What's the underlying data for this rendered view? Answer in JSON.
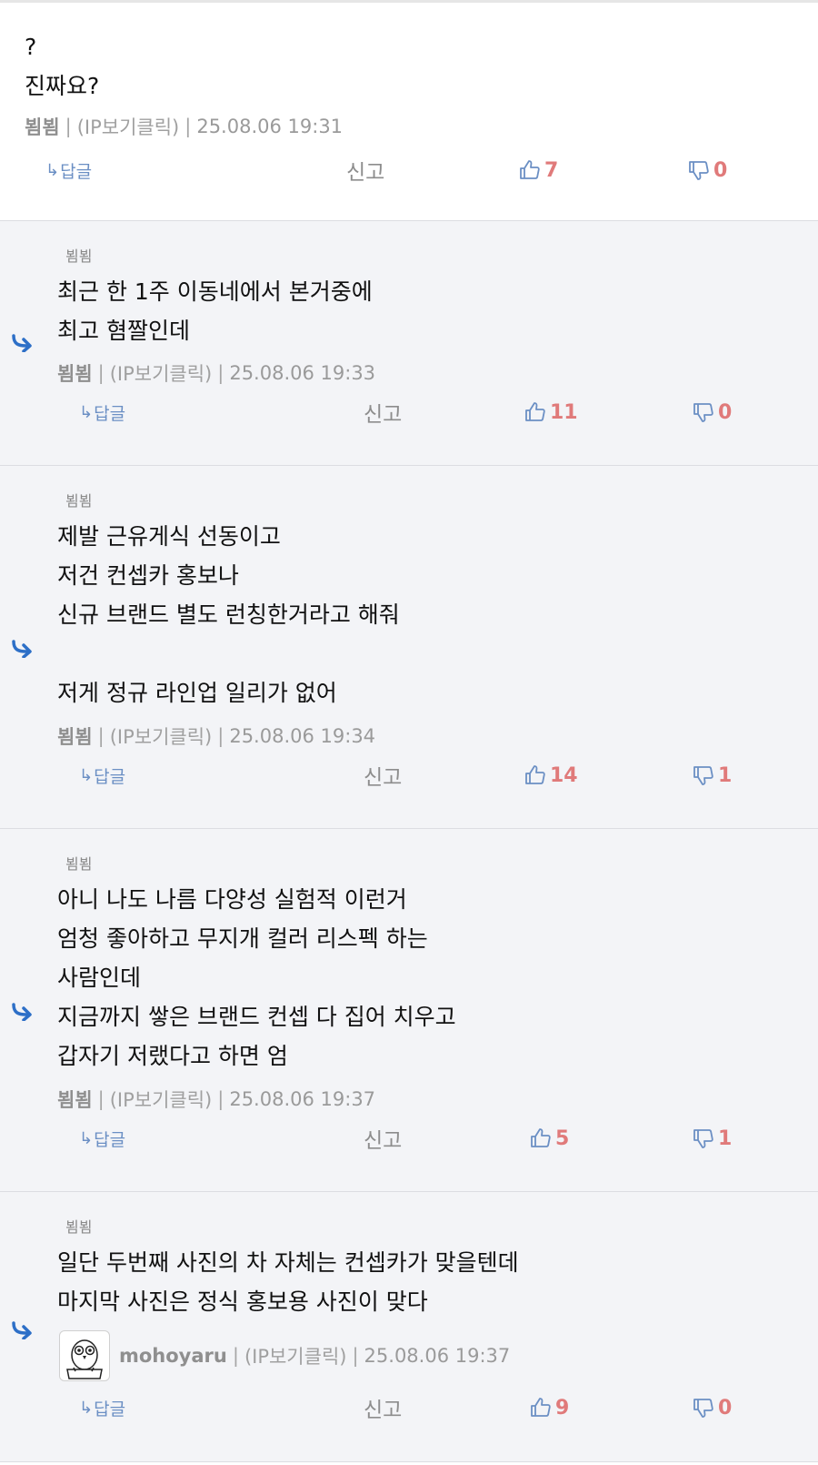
{
  "colors": {
    "reply_bg": "#f3f4f7",
    "accent_blue": "#6b8fc4",
    "vote_red": "#e07a7a",
    "meta_gray": "#9a9a9a"
  },
  "comments": [
    {
      "reply_to": "",
      "lines": [
        "?",
        "진짜요?"
      ],
      "nick": "뵘뵘",
      "ip_label": "(IP보기클릭)",
      "date": "25.08.06 19:31",
      "reply_label": "답글",
      "report_label": "신고",
      "up": "7",
      "down": "0"
    },
    {
      "reply_to": "뵘뵘",
      "lines": [
        "최근 한 1주 이동네에서 본거중에",
        "최고 혐짤인데"
      ],
      "nick": "뵘뵘",
      "ip_label": "(IP보기클릭)",
      "date": "25.08.06 19:33",
      "reply_label": "답글",
      "report_label": "신고",
      "up": "11",
      "down": "0"
    },
    {
      "reply_to": "뵘뵘",
      "lines": [
        "제발 근유게식 선동이고",
        "저건 컨셉카 홍보나",
        "신규 브랜드 별도 런칭한거라고 해줘",
        "",
        "저게 정규 라인업 일리가 없어"
      ],
      "nick": "뵘뵘",
      "ip_label": "(IP보기클릭)",
      "date": "25.08.06 19:34",
      "reply_label": "답글",
      "report_label": "신고",
      "up": "14",
      "down": "1"
    },
    {
      "reply_to": "뵘뵘",
      "lines": [
        "아니 나도 나름 다양성 실험적 이런거",
        "엄청 좋아하고 무지개 컬러 리스펙 하는",
        "사람인데",
        "지금까지 쌓은 브랜드 컨셉 다 집어 치우고",
        "갑자기 저랬다고 하면 엄"
      ],
      "nick": "뵘뵘",
      "ip_label": "(IP보기클릭)",
      "date": "25.08.06 19:37",
      "reply_label": "답글",
      "report_label": "신고",
      "up": "5",
      "down": "1"
    },
    {
      "reply_to": "뵘뵘",
      "lines": [
        "일단 두번째 사진의 차 자체는 컨셉카가 맞을텐데",
        "마지막 사진은 정식 홍보용 사진이 맞다"
      ],
      "nick": "mohoyaru",
      "ip_label": "(IP보기클릭)",
      "date": "25.08.06 19:37",
      "reply_label": "답글",
      "report_label": "신고",
      "up": "9",
      "down": "0"
    }
  ]
}
